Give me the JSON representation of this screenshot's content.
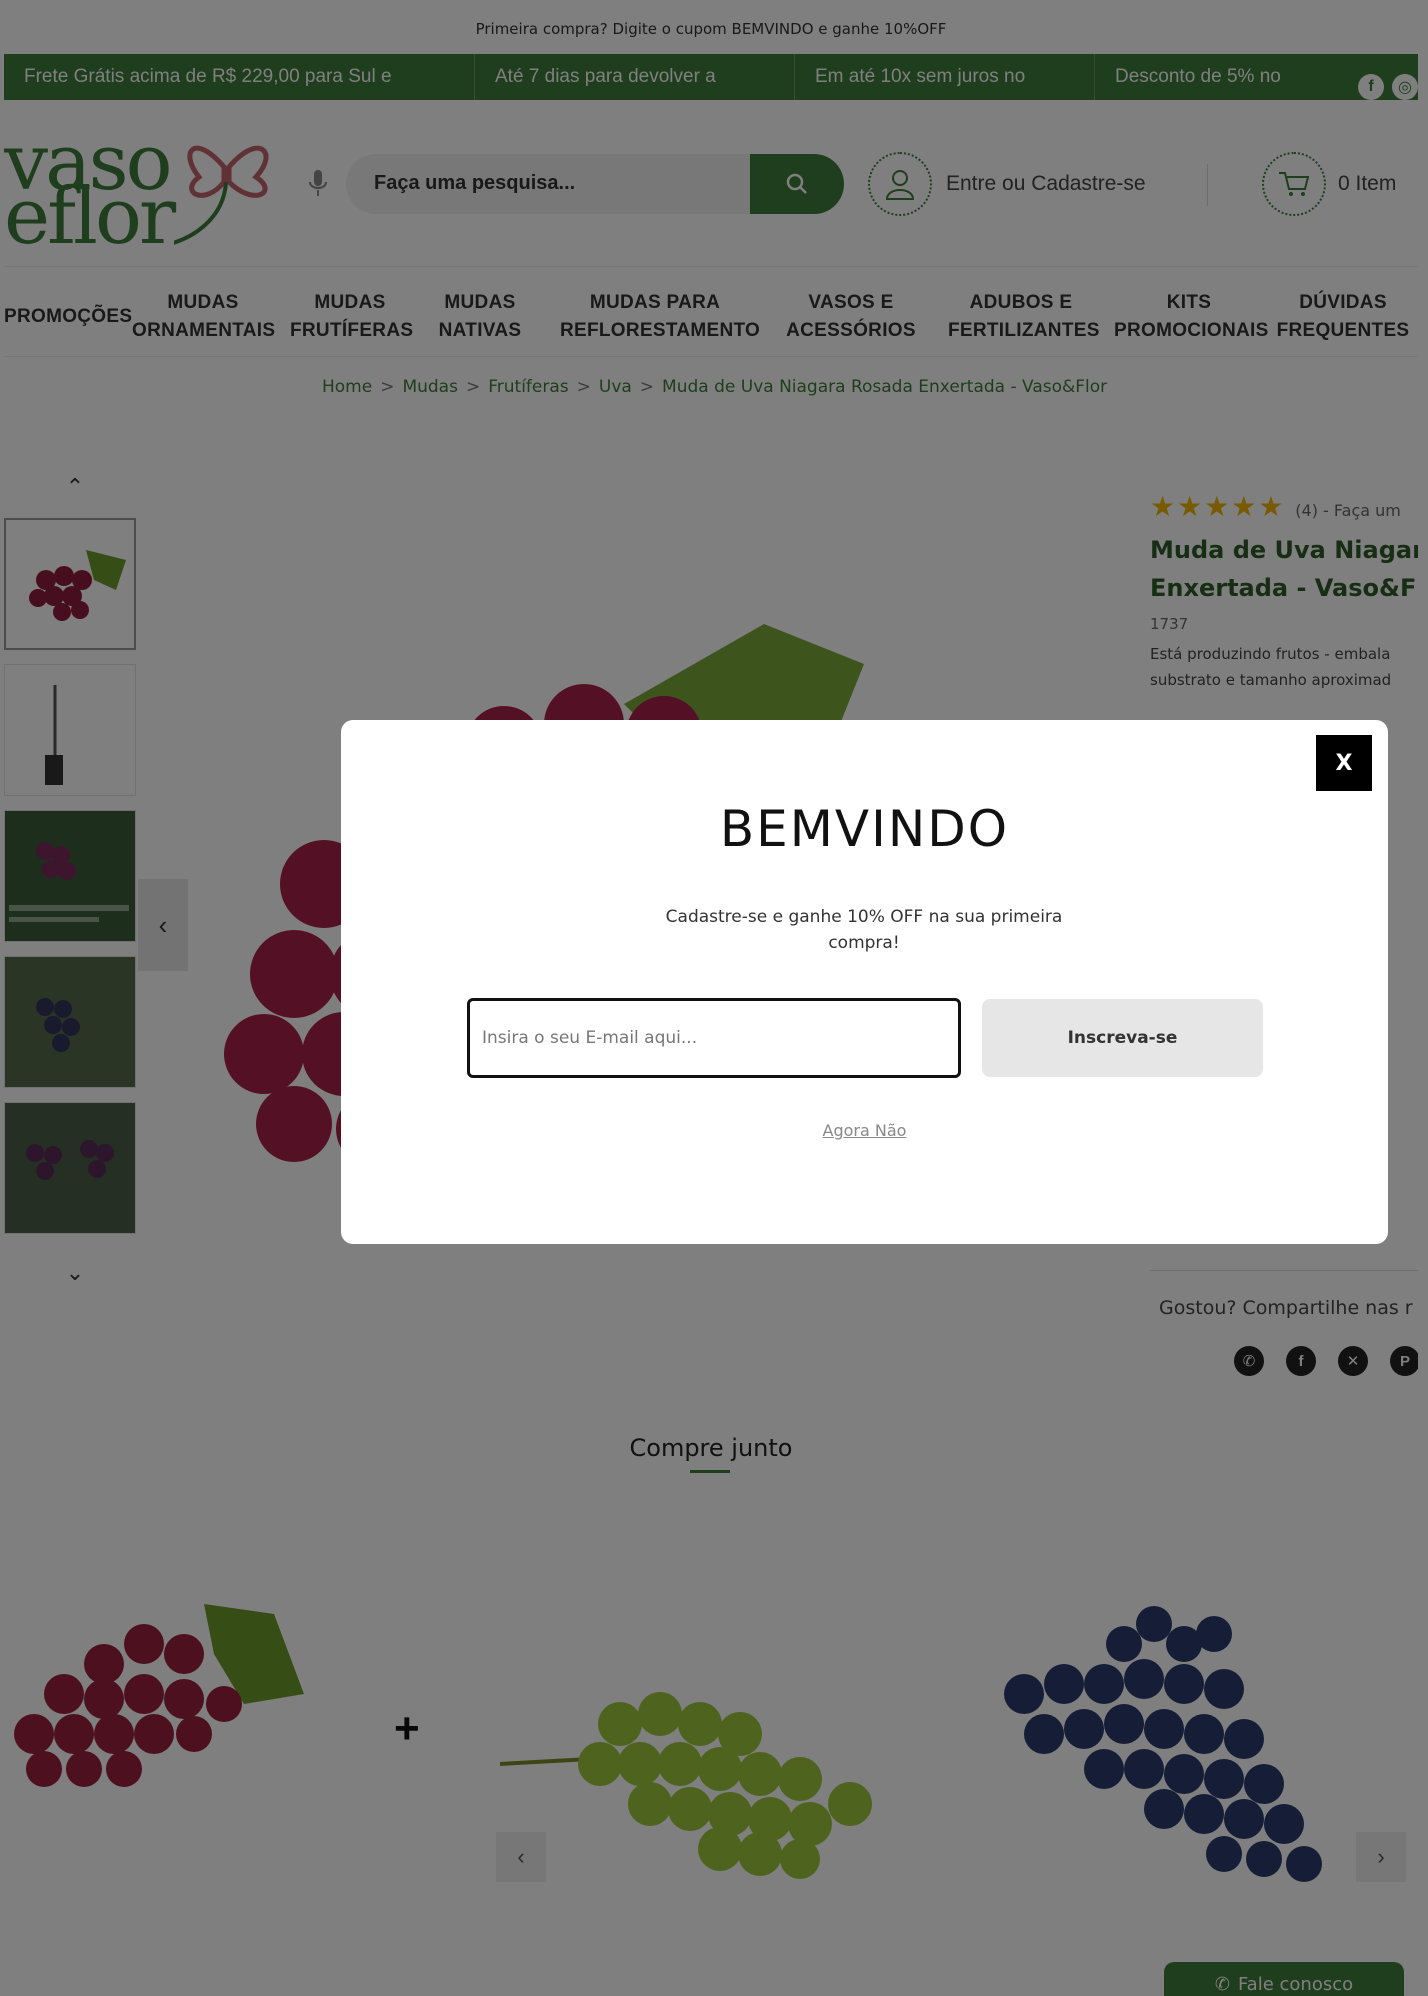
{
  "promo_top": "Primeira compra? Digite o cupom BEMVINDO e ganhe 10%OFF",
  "info_bar": [
    "Frete Grátis acima de R$ 229,00 para Sul e",
    "Até 7 dias para devolver a",
    "Em até 10x sem juros no",
    "Desconto de 5% no"
  ],
  "header": {
    "logo_line1": "vaso",
    "logo_line2": "eflor",
    "search_placeholder": "Faça uma pesquisa...",
    "account_label": "Entre ou Cadastre-se",
    "cart_label": "0 Item"
  },
  "nav": [
    {
      "line1": "PROMOÇÕES",
      "line2": ""
    },
    {
      "line1": "MUDAS",
      "line2": "ORNAMENTAIS"
    },
    {
      "line1": "MUDAS",
      "line2": "FRUTÍFERAS"
    },
    {
      "line1": "MUDAS",
      "line2": "NATIVAS"
    },
    {
      "line1": "MUDAS PARA",
      "line2": "REFLORESTAMENTO"
    },
    {
      "line1": "VASOS E",
      "line2": "ACESSÓRIOS"
    },
    {
      "line1": "ADUBOS E",
      "line2": "FERTILIZANTES"
    },
    {
      "line1": "KITS",
      "line2": "PROMOCIONAIS"
    },
    {
      "line1": "DÚVIDAS",
      "line2": "FREQUENTES"
    }
  ],
  "breadcrumb": [
    "Home",
    "Mudas",
    "Frutíferas",
    "Uva",
    "Muda de Uva Niagara Rosada Enxertada - Vaso&Flor"
  ],
  "product": {
    "stars": "★★★★★",
    "reviews": "(4) - Faça um",
    "title_line1": "Muda de Uva Niagara",
    "title_line2": "Enxertada - Vaso&Flo",
    "sku": "1737",
    "desc_line1": "Está produzindo frutos - embala",
    "desc_line2": "substrato e tamanho aproximad"
  },
  "share_label": "Gostou? Compartilhe nas r",
  "compre_junto": "Compre junto",
  "plus": "+",
  "fale_conosco": "Fale conosco",
  "modal": {
    "close": "X",
    "title": "BEMVINDO",
    "subtitle": "Cadastre-se e ganhe 10% OFF na sua primeira compra!",
    "email_placeholder": "Insira o seu E-mail aqui...",
    "subscribe": "Inscreva-se",
    "later": "Agora Não"
  },
  "colors": {
    "brand_green": "#3f7d3a",
    "star": "#f0b400"
  }
}
